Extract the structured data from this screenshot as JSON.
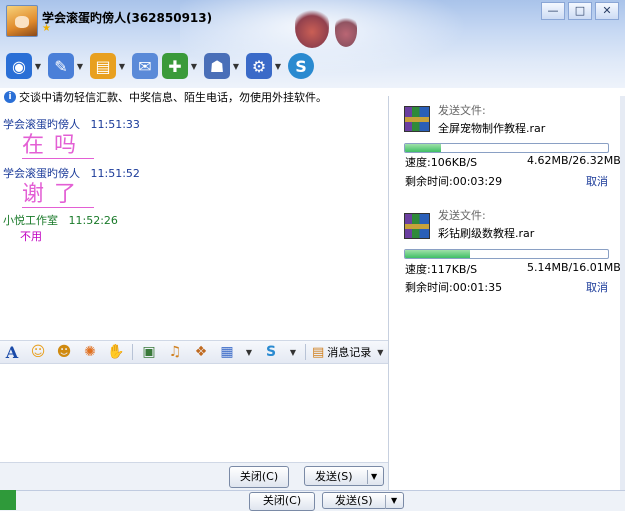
{
  "window": {
    "title": "学会滚蛋旳傍人(362850913)",
    "buttons": [
      "—",
      "□",
      "✕"
    ]
  },
  "toolbar": {
    "items": [
      {
        "name": "video-icon",
        "color": "#2a6fd6",
        "glyph": "◉"
      },
      {
        "name": "mic-icon",
        "color": "#4a7fd8",
        "glyph": "✎"
      },
      {
        "name": "send-file-icon",
        "color": "#e8a020",
        "glyph": "▤"
      },
      {
        "name": "message-icon",
        "color": "#5a8ad8",
        "glyph": "✉"
      },
      {
        "name": "add-icon",
        "color": "#3a9a3a",
        "glyph": "✚"
      },
      {
        "name": "apps-icon",
        "color": "#4a6fb8",
        "glyph": "☗"
      },
      {
        "name": "settings-icon",
        "color": "#3a6ac8",
        "glyph": "⚙"
      },
      {
        "name": "soso-icon",
        "color": "#2a8ad0",
        "glyph": "S"
      }
    ]
  },
  "notice": "交谈中请勿轻信汇款、中奖信息、陌生电话，勿使用外挂软件。",
  "messages": [
    {
      "sender": "学会滚蛋旳傍人",
      "time": "11:51:33",
      "text": "在吗"
    },
    {
      "sender": "学会滚蛋旳傍人",
      "time": "11:51:52",
      "text": "谢了"
    },
    {
      "sender": "小悦工作室",
      "time": "11:52:26",
      "text": "不用"
    }
  ],
  "inputbar": {
    "history_label": "消息记录"
  },
  "buttons": {
    "close": "关闭(C)",
    "send": "发送(S)",
    "close2": "关闭(C)",
    "send2": "发送(S)"
  },
  "transfers": [
    {
      "label": "发送文件:",
      "filename": "全屏宠物制作教程.rar",
      "progress": 0.175,
      "speed": "速度:106KB/S",
      "size": "4.62MB/26.32MB",
      "remaining": "剩余时间:00:03:29",
      "cancel": "取消"
    },
    {
      "label": "发送文件:",
      "filename": "彩钻刷级数教程.rar",
      "progress": 0.32,
      "speed": "速度:117KB/S",
      "size": "5.14MB/16.01MB",
      "remaining": "剩余时间:00:01:35",
      "cancel": "取消"
    }
  ]
}
